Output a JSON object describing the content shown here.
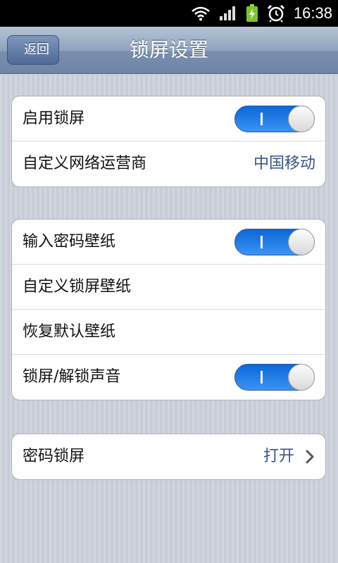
{
  "status_bar": {
    "time": "16:38",
    "icons": [
      "wifi-icon",
      "signal-icon",
      "battery-charging-icon",
      "alarm-icon"
    ]
  },
  "nav": {
    "title": "锁屏设置",
    "back_label": "返回"
  },
  "groups": [
    {
      "rows": [
        {
          "label": "启用锁屏",
          "toggle": true
        },
        {
          "label": "自定义网络运营商",
          "value": "中国移动"
        }
      ]
    },
    {
      "rows": [
        {
          "label": "输入密码壁纸",
          "toggle": true
        },
        {
          "label": "自定义锁屏壁纸"
        },
        {
          "label": "恢复默认壁纸"
        },
        {
          "label": "锁屏/解锁声音",
          "toggle": true
        }
      ]
    },
    {
      "rows": [
        {
          "label": "密码锁屏",
          "value": "打开",
          "chevron": true
        }
      ]
    }
  ],
  "colors": {
    "toggle_on": "#1a78e8",
    "value_text": "#385487",
    "nav_bar": "#8ea2bd",
    "background": "#c7ccd6"
  }
}
